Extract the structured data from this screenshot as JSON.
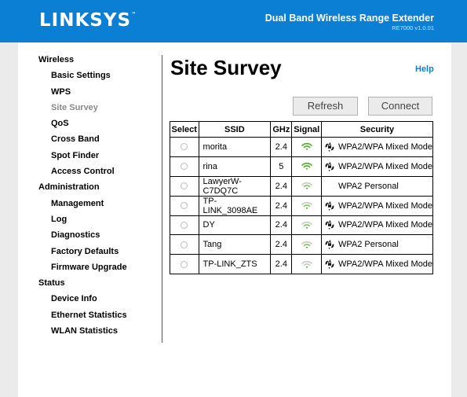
{
  "header": {
    "logo": "LINKSYS",
    "logo_tm": "™",
    "product": "Dual Band Wireless Range Extender",
    "version": "RE7000 v1.0.01"
  },
  "sidebar": {
    "sections": [
      {
        "label": "Wireless",
        "items": [
          "Basic Settings",
          "WPS",
          "Site Survey",
          "QoS",
          "Cross Band",
          "Spot Finder",
          "Access Control"
        ]
      },
      {
        "label": "Administration",
        "items": [
          "Management",
          "Log",
          "Diagnostics",
          "Factory Defaults",
          "Firmware Upgrade"
        ]
      },
      {
        "label": "Status",
        "items": [
          "Device Info",
          "Ethernet Statistics",
          "WLAN Statistics"
        ]
      }
    ],
    "active": "Site Survey"
  },
  "page": {
    "title": "Site Survey",
    "help": "Help",
    "refresh_label": "Refresh",
    "connect_label": "Connect"
  },
  "table": {
    "headers": [
      "Select",
      "SSID",
      "GHz",
      "Signal",
      "Security"
    ],
    "rows": [
      {
        "ssid": "morita",
        "ghz": "2.4",
        "signal": 3,
        "secure": true,
        "security": "WPA2/WPA Mixed Mode"
      },
      {
        "ssid": "rina",
        "ghz": "5",
        "signal": 3,
        "secure": true,
        "security": "WPA2/WPA Mixed Mode"
      },
      {
        "ssid": "LawyerW-C7DQ7C",
        "ghz": "2.4",
        "signal": 2,
        "secure": false,
        "security": "WPA2 Personal"
      },
      {
        "ssid": "TP-LINK_3098AE",
        "ghz": "2.4",
        "signal": 2,
        "secure": true,
        "security": "WPA2/WPA Mixed Mode"
      },
      {
        "ssid": "DY",
        "ghz": "2.4",
        "signal": 2,
        "secure": true,
        "security": "WPA2/WPA Mixed Mode"
      },
      {
        "ssid": "Tang",
        "ghz": "2.4",
        "signal": 2,
        "secure": true,
        "security": "WPA2 Personal"
      },
      {
        "ssid": "TP-LINK_ZTS",
        "ghz": "2.4",
        "signal": 1,
        "secure": true,
        "security": "WPA2/WPA Mixed Mode"
      }
    ]
  },
  "colors": {
    "brand": "#0b7fd4",
    "signal_on": "#4caf2a",
    "signal_mid": "#7ccc55",
    "signal_off": "#c9c9c9"
  },
  "icons": {
    "signal": "wifi-signal-icon",
    "security": "lock-icon",
    "select": "radio-button"
  }
}
